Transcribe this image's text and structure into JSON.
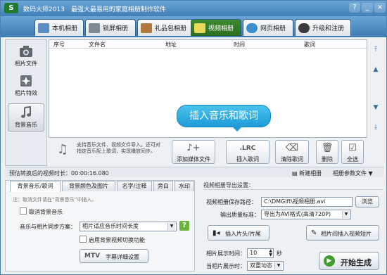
{
  "window": {
    "logo": "S",
    "title": "数码大师2013　最强大最易用的家庭相册制作软件",
    "controls": [
      "?",
      "_",
      "×"
    ]
  },
  "tabs": [
    {
      "label": "本机相册",
      "icon": "album-icon"
    },
    {
      "label": "锁屏相册",
      "icon": "monitor-icon"
    },
    {
      "label": "礼品包相册",
      "icon": "gift-icon"
    },
    {
      "label": "视频相册",
      "icon": "film-icon",
      "active": true
    },
    {
      "label": "网页相册",
      "icon": "web-icon"
    },
    {
      "label": "升级和注册",
      "icon": "upgrade-icon"
    }
  ],
  "sidebar": [
    {
      "label": "相片文件",
      "icon": "camera-icon"
    },
    {
      "label": "相片特效",
      "icon": "effects-icon"
    },
    {
      "label": "背景音乐",
      "icon": "music-note-icon",
      "active": true
    }
  ],
  "grid": {
    "columns": [
      "序号",
      "文件名",
      "地址",
      "时间",
      "歌词"
    ]
  },
  "tooltip": "插入音乐和歌词",
  "toolbar": {
    "note": "支持音乐文件、视频文件导入。还可对指定音乐配上歌词，实现播放同步。",
    "add_media": "添加媒体文件",
    "insert_lrc_icon": ".LRC",
    "insert_lyrics": "插入歌词",
    "clear_lyrics": "清除歌词",
    "delete": "删除",
    "select_all": "全选"
  },
  "status": {
    "estimate_label": "预估转换后的视频时长：",
    "estimate_value": "00:00:16.080",
    "new_album": "新建相册",
    "album_params": "相册参数文件"
  },
  "left_panel": {
    "tabs": [
      "背景音乐/歌词",
      "背景颜色及图片",
      "名字/注释",
      "旁白",
      "水印"
    ],
    "note": "注：取消文件请在“背景音乐”中插入。",
    "cancel_music": "取消背景音乐",
    "sync_label": "音乐与相片同步方案：",
    "sync_value": "相片适应音乐时间长度",
    "enable_switch": "启用背景视频切换功能",
    "mtv_button": "字幕详细设置",
    "mtv_label": "MTV",
    "help": "?"
  },
  "right_panel": {
    "title": "视频相册导出设置：",
    "save_path_label": "视频相册保存路径：",
    "save_path_value": "C:\\DMGift\\视频相册.avi",
    "browse": "浏览",
    "quality_label": "输出质量标准：",
    "quality_value": "导出为AVI格式(高清720P)",
    "insert_opening": "插入片头/片尾",
    "insert_between": "相片间插入视频短片",
    "display_time_label": "相片展示时间：",
    "display_time_value": "10",
    "display_time_unit": "秒",
    "display_mode_label": "当相片展示时：",
    "display_mode_value": "双重动态",
    "generate": "开始生成"
  }
}
